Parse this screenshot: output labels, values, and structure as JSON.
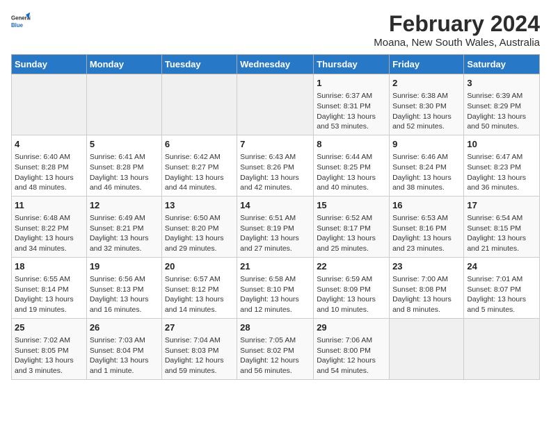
{
  "logo": {
    "line1": "General",
    "line2": "Blue"
  },
  "title": "February 2024",
  "location": "Moana, New South Wales, Australia",
  "days_header": [
    "Sunday",
    "Monday",
    "Tuesday",
    "Wednesday",
    "Thursday",
    "Friday",
    "Saturday"
  ],
  "weeks": [
    [
      {
        "day": "",
        "info": ""
      },
      {
        "day": "",
        "info": ""
      },
      {
        "day": "",
        "info": ""
      },
      {
        "day": "",
        "info": ""
      },
      {
        "day": "1",
        "info": "Sunrise: 6:37 AM\nSunset: 8:31 PM\nDaylight: 13 hours\nand 53 minutes."
      },
      {
        "day": "2",
        "info": "Sunrise: 6:38 AM\nSunset: 8:30 PM\nDaylight: 13 hours\nand 52 minutes."
      },
      {
        "day": "3",
        "info": "Sunrise: 6:39 AM\nSunset: 8:29 PM\nDaylight: 13 hours\nand 50 minutes."
      }
    ],
    [
      {
        "day": "4",
        "info": "Sunrise: 6:40 AM\nSunset: 8:28 PM\nDaylight: 13 hours\nand 48 minutes."
      },
      {
        "day": "5",
        "info": "Sunrise: 6:41 AM\nSunset: 8:28 PM\nDaylight: 13 hours\nand 46 minutes."
      },
      {
        "day": "6",
        "info": "Sunrise: 6:42 AM\nSunset: 8:27 PM\nDaylight: 13 hours\nand 44 minutes."
      },
      {
        "day": "7",
        "info": "Sunrise: 6:43 AM\nSunset: 8:26 PM\nDaylight: 13 hours\nand 42 minutes."
      },
      {
        "day": "8",
        "info": "Sunrise: 6:44 AM\nSunset: 8:25 PM\nDaylight: 13 hours\nand 40 minutes."
      },
      {
        "day": "9",
        "info": "Sunrise: 6:46 AM\nSunset: 8:24 PM\nDaylight: 13 hours\nand 38 minutes."
      },
      {
        "day": "10",
        "info": "Sunrise: 6:47 AM\nSunset: 8:23 PM\nDaylight: 13 hours\nand 36 minutes."
      }
    ],
    [
      {
        "day": "11",
        "info": "Sunrise: 6:48 AM\nSunset: 8:22 PM\nDaylight: 13 hours\nand 34 minutes."
      },
      {
        "day": "12",
        "info": "Sunrise: 6:49 AM\nSunset: 8:21 PM\nDaylight: 13 hours\nand 32 minutes."
      },
      {
        "day": "13",
        "info": "Sunrise: 6:50 AM\nSunset: 8:20 PM\nDaylight: 13 hours\nand 29 minutes."
      },
      {
        "day": "14",
        "info": "Sunrise: 6:51 AM\nSunset: 8:19 PM\nDaylight: 13 hours\nand 27 minutes."
      },
      {
        "day": "15",
        "info": "Sunrise: 6:52 AM\nSunset: 8:17 PM\nDaylight: 13 hours\nand 25 minutes."
      },
      {
        "day": "16",
        "info": "Sunrise: 6:53 AM\nSunset: 8:16 PM\nDaylight: 13 hours\nand 23 minutes."
      },
      {
        "day": "17",
        "info": "Sunrise: 6:54 AM\nSunset: 8:15 PM\nDaylight: 13 hours\nand 21 minutes."
      }
    ],
    [
      {
        "day": "18",
        "info": "Sunrise: 6:55 AM\nSunset: 8:14 PM\nDaylight: 13 hours\nand 19 minutes."
      },
      {
        "day": "19",
        "info": "Sunrise: 6:56 AM\nSunset: 8:13 PM\nDaylight: 13 hours\nand 16 minutes."
      },
      {
        "day": "20",
        "info": "Sunrise: 6:57 AM\nSunset: 8:12 PM\nDaylight: 13 hours\nand 14 minutes."
      },
      {
        "day": "21",
        "info": "Sunrise: 6:58 AM\nSunset: 8:10 PM\nDaylight: 13 hours\nand 12 minutes."
      },
      {
        "day": "22",
        "info": "Sunrise: 6:59 AM\nSunset: 8:09 PM\nDaylight: 13 hours\nand 10 minutes."
      },
      {
        "day": "23",
        "info": "Sunrise: 7:00 AM\nSunset: 8:08 PM\nDaylight: 13 hours\nand 8 minutes."
      },
      {
        "day": "24",
        "info": "Sunrise: 7:01 AM\nSunset: 8:07 PM\nDaylight: 13 hours\nand 5 minutes."
      }
    ],
    [
      {
        "day": "25",
        "info": "Sunrise: 7:02 AM\nSunset: 8:05 PM\nDaylight: 13 hours\nand 3 minutes."
      },
      {
        "day": "26",
        "info": "Sunrise: 7:03 AM\nSunset: 8:04 PM\nDaylight: 13 hours\nand 1 minute."
      },
      {
        "day": "27",
        "info": "Sunrise: 7:04 AM\nSunset: 8:03 PM\nDaylight: 12 hours\nand 59 minutes."
      },
      {
        "day": "28",
        "info": "Sunrise: 7:05 AM\nSunset: 8:02 PM\nDaylight: 12 hours\nand 56 minutes."
      },
      {
        "day": "29",
        "info": "Sunrise: 7:06 AM\nSunset: 8:00 PM\nDaylight: 12 hours\nand 54 minutes."
      },
      {
        "day": "",
        "info": ""
      },
      {
        "day": "",
        "info": ""
      }
    ]
  ]
}
